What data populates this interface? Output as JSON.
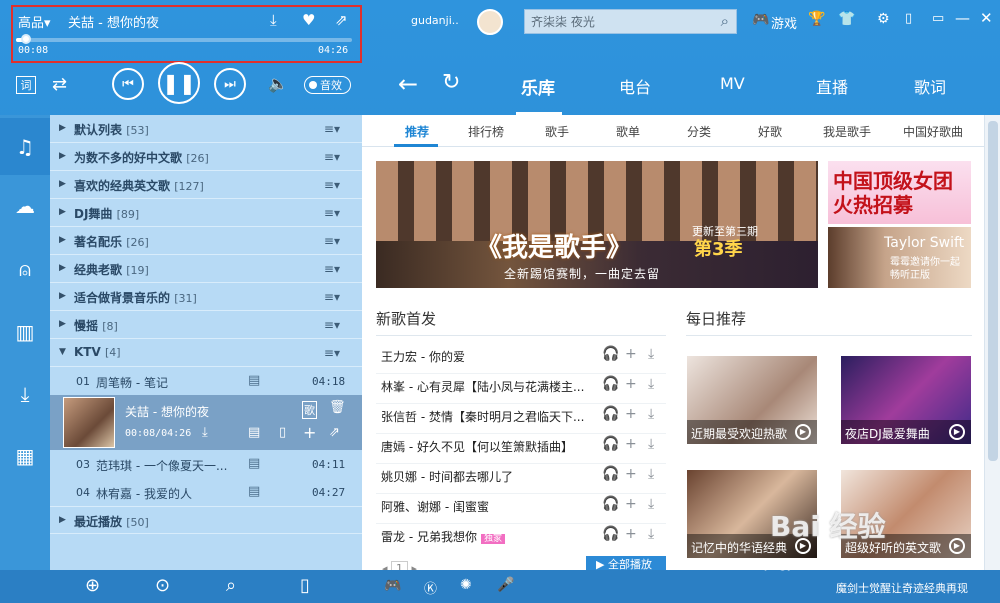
{
  "player": {
    "quality": "高品▾",
    "title": "关喆 - 想你的夜",
    "elapsed": "00:08",
    "total": "04:26",
    "progress": 0.03,
    "effect_label": "音效"
  },
  "header": {
    "username": "gudanji..",
    "search_value": "齐柒柒 夜光",
    "game_label": "游戏",
    "nav": [
      "乐库",
      "电台",
      "MV",
      "直播",
      "歌词"
    ],
    "nav_active": 0
  },
  "playlists": [
    {
      "name": "默认列表",
      "count": "[53]"
    },
    {
      "name": "为数不多的好中文歌",
      "count": "[26]"
    },
    {
      "name": "喜欢的经典英文歌",
      "count": "[127]"
    },
    {
      "name": "DJ舞曲",
      "count": "[89]"
    },
    {
      "name": "著名配乐",
      "count": "[26]"
    },
    {
      "name": "经典老歌",
      "count": "[19]"
    },
    {
      "name": "适合做背景音乐的",
      "count": "[31]"
    },
    {
      "name": "慢摇",
      "count": "[8]"
    },
    {
      "name": "KTV",
      "count": "[4]"
    }
  ],
  "ktv_songs": [
    {
      "no": "01",
      "title": "周笔畅 - 笔记",
      "dur": "04:18"
    },
    {
      "no": "03",
      "title": "范玮琪 - 一个像夏天一...",
      "dur": "04:11"
    },
    {
      "no": "04",
      "title": "林宥嘉 - 我爱的人",
      "dur": "04:27"
    }
  ],
  "now_playing": {
    "title": "关喆 - 想你的夜",
    "time": "00:08/04:26"
  },
  "recent": {
    "name": "最近播放",
    "count": "[50]"
  },
  "subtabs": [
    "推荐",
    "排行榜",
    "歌手",
    "歌单",
    "分类",
    "好歌",
    "我是歌手",
    "中国好歌曲"
  ],
  "banner": {
    "main": "《我是歌手》",
    "update": "更新至第三期",
    "season": "第3季",
    "slogan": "全新踢馆赛制，一曲定去留",
    "ad1": "中国顶级女团火热招募",
    "ad2_name": "Taylor Swift",
    "ad2_sub": "霉霉邀请你一起畅听正版"
  },
  "new_songs": {
    "heading": "新歌首发",
    "items": [
      {
        "title": "王力宏 - 你的爱",
        "tag": ""
      },
      {
        "title": "林峯 - 心有灵犀【陆小凤与花满楼主...",
        "tag": ""
      },
      {
        "title": "张信哲 - 焚情【秦时明月之君临天下...",
        "tag": ""
      },
      {
        "title": "唐嫣 - 好久不见【何以笙箫默插曲】",
        "tag": ""
      },
      {
        "title": "姚贝娜 - 时间都去哪儿了",
        "tag": ""
      },
      {
        "title": "阿雅、谢娜 - 闺蜜蜜",
        "tag": ""
      },
      {
        "title": "雷龙 - 兄弟我想你",
        "tag": "独家"
      }
    ],
    "play_all": "全部播放",
    "page": "1"
  },
  "daily": {
    "heading": "每日推荐",
    "items": [
      {
        "caption": "近期最受欢迎热歌"
      },
      {
        "caption": "夜店DJ最爱舞曲"
      },
      {
        "caption": "记忆中的华语经典"
      },
      {
        "caption": "超级好听的英文歌"
      }
    ]
  },
  "bottom": {
    "message": "魔剑士觉醒让奇迹经典再现"
  },
  "watermark": {
    "brand": "Bai 经验",
    "url": "jingyan.baidu.com"
  }
}
